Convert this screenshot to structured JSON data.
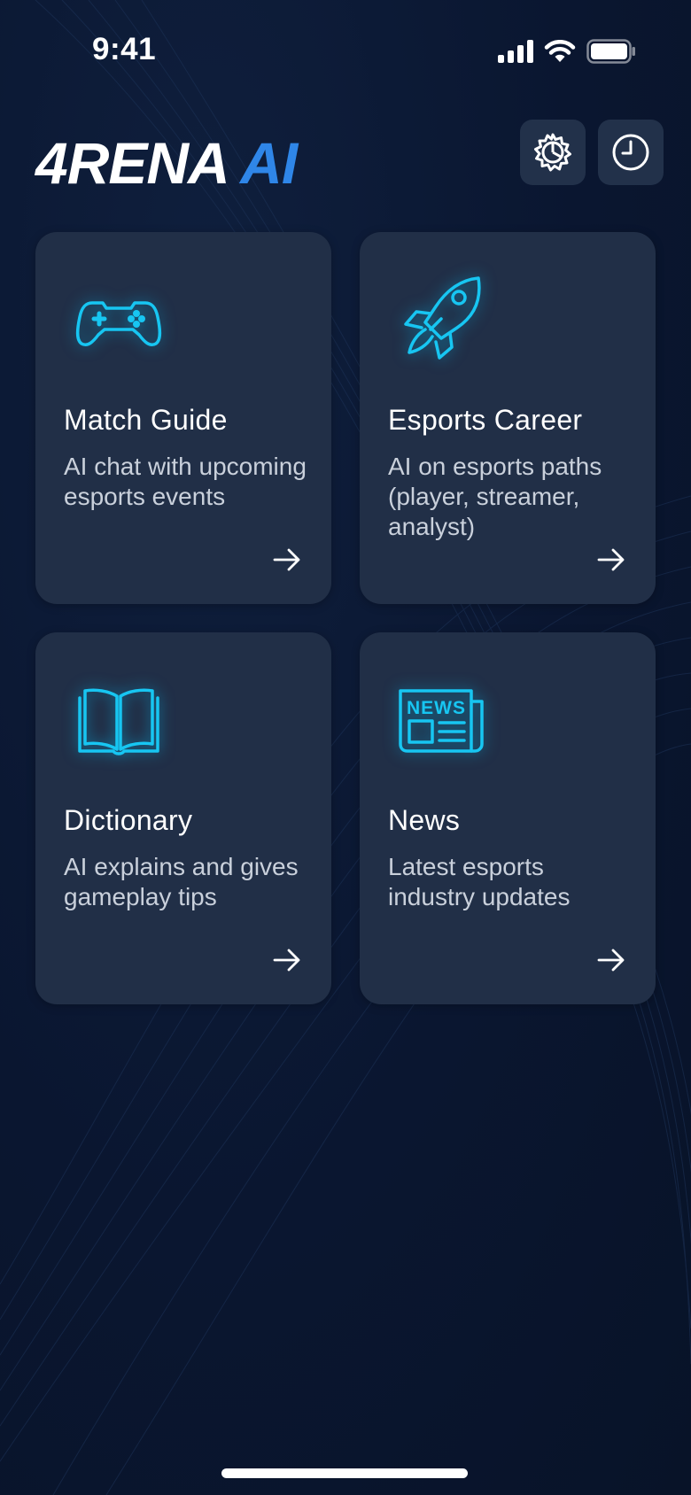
{
  "status_bar": {
    "time": "9:41",
    "icons": [
      "cellular-signal-icon",
      "wifi-icon",
      "battery-icon"
    ]
  },
  "header": {
    "logo_brand": "4RENA",
    "logo_accent": "AI",
    "accent_color": "#2f86e8",
    "buttons": [
      {
        "name": "settings-button",
        "icon": "gear-icon"
      },
      {
        "name": "history-button",
        "icon": "clock-icon"
      }
    ]
  },
  "cards": [
    {
      "title": "Match Guide",
      "description": "AI chat with upcoming esports events",
      "icon": "gamepad-icon"
    },
    {
      "title": "Esports Career",
      "description": "AI on esports paths (player, streamer, analyst)",
      "icon": "rocket-icon"
    },
    {
      "title": "Dictionary",
      "description": "AI explains and gives gameplay tips",
      "icon": "book-icon"
    },
    {
      "title": "News",
      "description": "Latest esports industry updates",
      "icon": "newspaper-icon",
      "icon_text": "NEWS"
    }
  ],
  "colors": {
    "background": "#0b1730",
    "card": "#212f47",
    "icon_glow": "#17c6f2"
  }
}
